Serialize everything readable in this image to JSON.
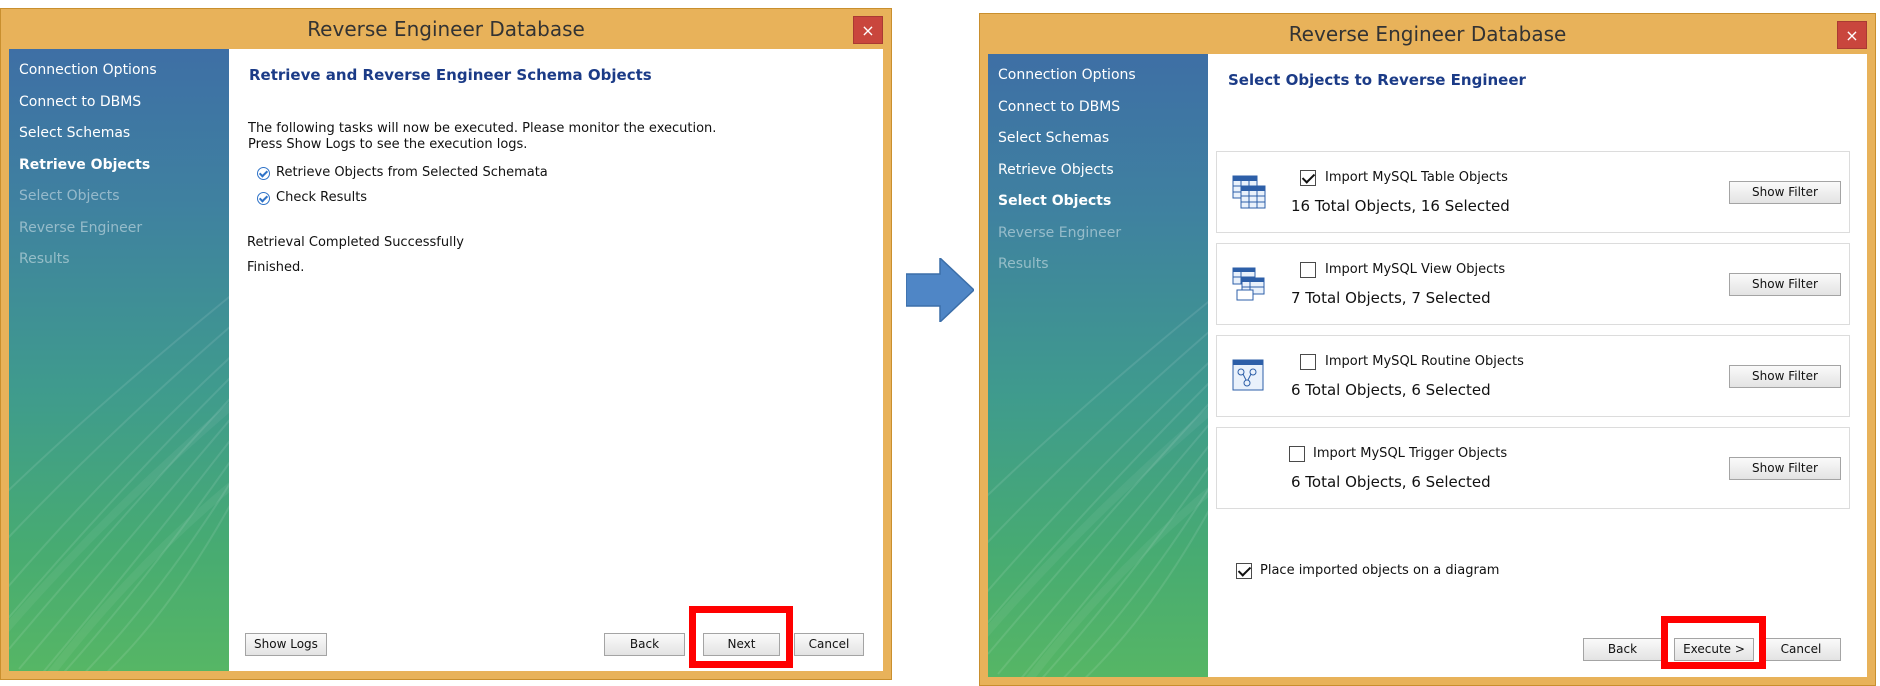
{
  "step1": {
    "title": "Reverse Engineer Database",
    "close_icon": "×",
    "nav": [
      {
        "label": "Connection Options",
        "state": "done"
      },
      {
        "label": "Connect to DBMS",
        "state": "done"
      },
      {
        "label": "Select Schemas",
        "state": "done"
      },
      {
        "label": "Retrieve Objects",
        "state": "active"
      },
      {
        "label": "Select Objects",
        "state": "disabled"
      },
      {
        "label": "Reverse Engineer",
        "state": "disabled"
      },
      {
        "label": "Results",
        "state": "disabled"
      }
    ],
    "heading": "Retrieve and Reverse Engineer Schema Objects",
    "description_line1": "The following tasks will now be executed. Please monitor the execution.",
    "description_line2": "Press Show Logs to see the execution logs.",
    "tasks": [
      {
        "label": "Retrieve Objects from Selected Schemata",
        "done": true
      },
      {
        "label": "Check Results",
        "done": true
      }
    ],
    "status": "Retrieval Completed Successfully",
    "finished": "Finished.",
    "buttons": {
      "show_logs": "Show Logs",
      "back": "Back",
      "next": "Next",
      "cancel": "Cancel"
    }
  },
  "step2": {
    "title": "Reverse Engineer Database",
    "close_icon": "×",
    "nav": [
      {
        "label": "Connection Options",
        "state": "done"
      },
      {
        "label": "Connect to DBMS",
        "state": "done"
      },
      {
        "label": "Select Schemas",
        "state": "done"
      },
      {
        "label": "Retrieve Objects",
        "state": "done"
      },
      {
        "label": "Select Objects",
        "state": "active"
      },
      {
        "label": "Reverse Engineer",
        "state": "disabled"
      },
      {
        "label": "Results",
        "state": "disabled"
      }
    ],
    "heading": "Select Objects to Reverse Engineer",
    "objects": [
      {
        "label": "Import MySQL Table Objects",
        "checked": true,
        "count": "16 Total Objects, 16 Selected",
        "filter": "Show Filter",
        "icon": "table-objects-icon"
      },
      {
        "label": "Import MySQL View Objects",
        "checked": false,
        "count": "7 Total Objects, 7 Selected",
        "filter": "Show Filter",
        "icon": "view-objects-icon"
      },
      {
        "label": "Import MySQL Routine Objects",
        "checked": false,
        "count": "6 Total Objects, 6 Selected",
        "filter": "Show Filter",
        "icon": "routine-objects-icon"
      },
      {
        "label": "Import MySQL Trigger Objects",
        "checked": false,
        "count": "6 Total Objects, 6 Selected",
        "filter": "Show Filter",
        "icon": ""
      }
    ],
    "place_on_diagram": {
      "label": "Place imported objects on a diagram",
      "checked": true
    },
    "buttons": {
      "back": "Back",
      "execute": "Execute >",
      "cancel": "Cancel"
    }
  },
  "colors": {
    "frame": "#e8b25a",
    "highlight": "#ff0000",
    "heading": "#1b3b87",
    "arrow": "#4f86c6",
    "close": "#c9463d"
  }
}
